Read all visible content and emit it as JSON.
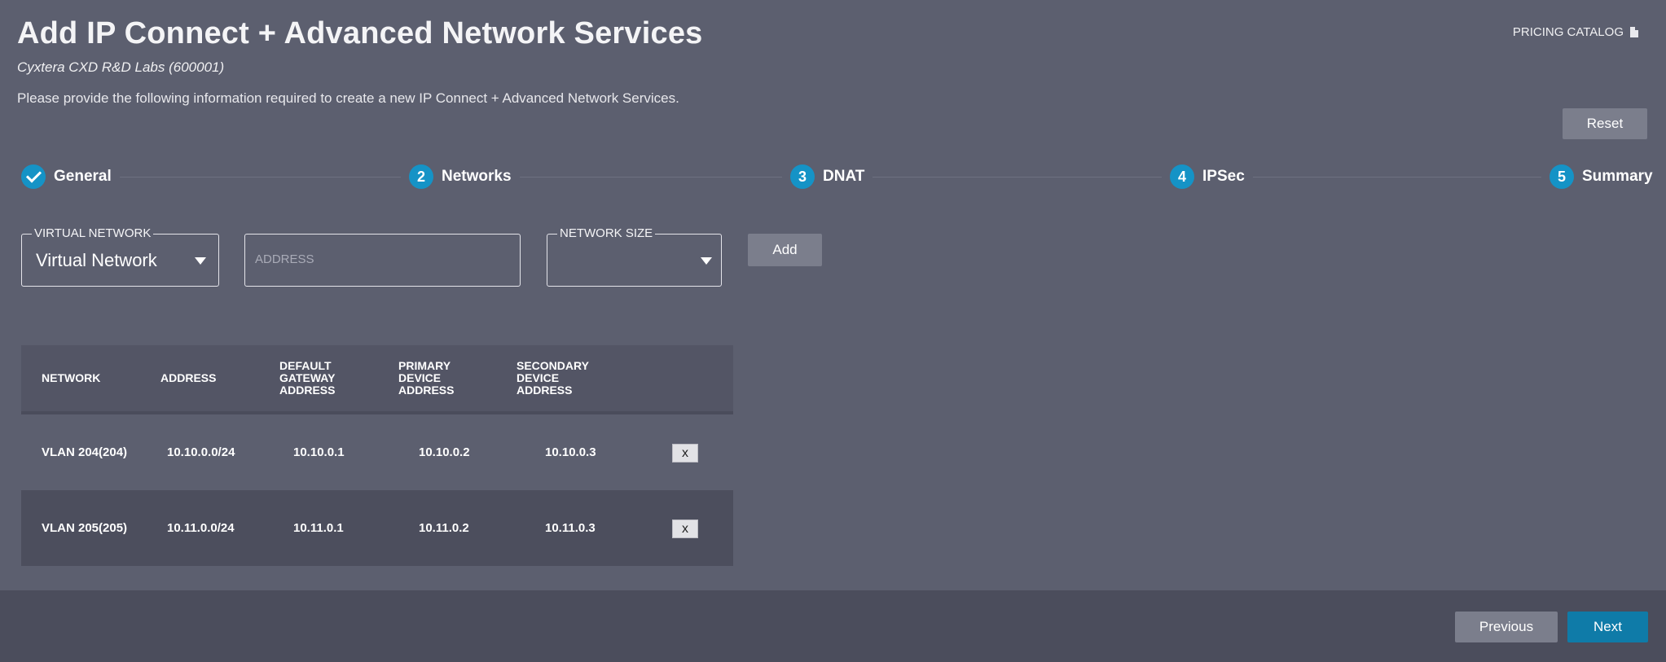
{
  "header": {
    "title": "Add IP Connect + Advanced Network Services",
    "subtitle": "Cyxtera CXD R&D Labs (600001)",
    "description": "Please provide the following information required to create a new IP Connect + Advanced Network Services.",
    "pricing_catalog": "PRICING CATALOG",
    "pricing_icon": "pdf-file-icon"
  },
  "buttons": {
    "reset": "Reset",
    "add": "Add",
    "previous": "Previous",
    "next": "Next"
  },
  "colors": {
    "accent": "#1593c6",
    "primary_button": "#0f7ba8",
    "background": "#5c5f6f",
    "footer": "#4b4d5c"
  },
  "steps": [
    {
      "number": "1",
      "label": "General",
      "status": "complete"
    },
    {
      "number": "2",
      "label": "Networks",
      "status": "current"
    },
    {
      "number": "3",
      "label": "DNAT",
      "status": "pending"
    },
    {
      "number": "4",
      "label": "IPSec",
      "status": "pending"
    },
    {
      "number": "5",
      "label": "Summary",
      "status": "pending"
    }
  ],
  "form": {
    "virtual_network": {
      "label": "VIRTUAL NETWORK",
      "value": "Virtual Network"
    },
    "address": {
      "placeholder": "ADDRESS",
      "value": ""
    },
    "network_size": {
      "label": "NETWORK SIZE",
      "value": ""
    }
  },
  "table": {
    "headers": [
      "NETWORK",
      "ADDRESS",
      "DEFAULT GATEWAY ADDRESS",
      "PRIMARY DEVICE ADDRESS",
      "SECONDARY DEVICE ADDRESS"
    ],
    "header_lines": [
      [
        "NETWORK"
      ],
      [
        "ADDRESS"
      ],
      [
        "DEFAULT",
        "GATEWAY",
        "ADDRESS"
      ],
      [
        "PRIMARY",
        "DEVICE",
        "ADDRESS"
      ],
      [
        "SECONDARY",
        "DEVICE",
        "ADDRESS"
      ]
    ],
    "rows": [
      {
        "network": "VLAN 204(204)",
        "address": "10.10.0.0/24",
        "gateway": "10.10.0.1",
        "primary": "10.10.0.2",
        "secondary": "10.10.0.3",
        "delete": "x"
      },
      {
        "network": "VLAN 205(205)",
        "address": "10.11.0.0/24",
        "gateway": "10.11.0.1",
        "primary": "10.11.0.2",
        "secondary": "10.11.0.3",
        "delete": "x"
      }
    ]
  }
}
